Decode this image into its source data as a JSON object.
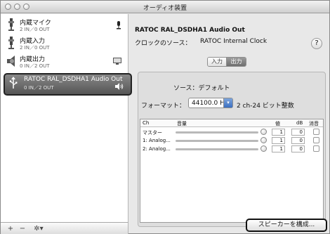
{
  "window": {
    "title": "オーディオ装置"
  },
  "devices": [
    {
      "name": "内蔵マイク",
      "sub": "2 IN／0 OUT",
      "icon": "mic-device-icon",
      "badge": "microphone-badge-icon"
    },
    {
      "name": "内蔵入力",
      "sub": "2 IN／0 OUT",
      "icon": "line-in-device-icon"
    },
    {
      "name": "内蔵出力",
      "sub": "0 IN／2 OUT",
      "icon": "speaker-device-icon",
      "badge": "display-badge-icon"
    },
    {
      "name": "RATOC RAL_DSDHA1 Audio Out",
      "sub": "0 IN／2 OUT",
      "icon": "usb-device-icon",
      "badge": "speaker-badge-icon",
      "selected": true
    }
  ],
  "sidebar_footer": {
    "add": "+",
    "remove": "−",
    "gear": "✲▾"
  },
  "detail": {
    "device_title": "RATOC RAL_DSDHA1 Audio Out",
    "clock_label": "クロックのソース：",
    "clock_value": "RATOC Internal Clock",
    "help": "?",
    "tabs": {
      "input": "入力",
      "output": "出力",
      "active": "output"
    },
    "source_label": "ソース：デフォルト",
    "format_label": "フォーマット：",
    "format_value": "44100.0 Hz",
    "format_extra": "2 ch-24 ビット整数",
    "table": {
      "headers": {
        "ch": "Ch",
        "volume": "音量",
        "value": "値",
        "db": "dB",
        "mute": "消音"
      },
      "rows": [
        {
          "ch": "マスター",
          "value": "1",
          "db": "0",
          "level": 1.0
        },
        {
          "ch": "1: Analog...",
          "value": "1",
          "db": "0",
          "level": 1.0
        },
        {
          "ch": "2: Analog...",
          "value": "1",
          "db": "0",
          "level": 1.0
        }
      ]
    },
    "configure_button": "スピーカーを構成..."
  },
  "colors": {
    "selected": "#5a5a5a",
    "accent": "#3b6fc0"
  }
}
